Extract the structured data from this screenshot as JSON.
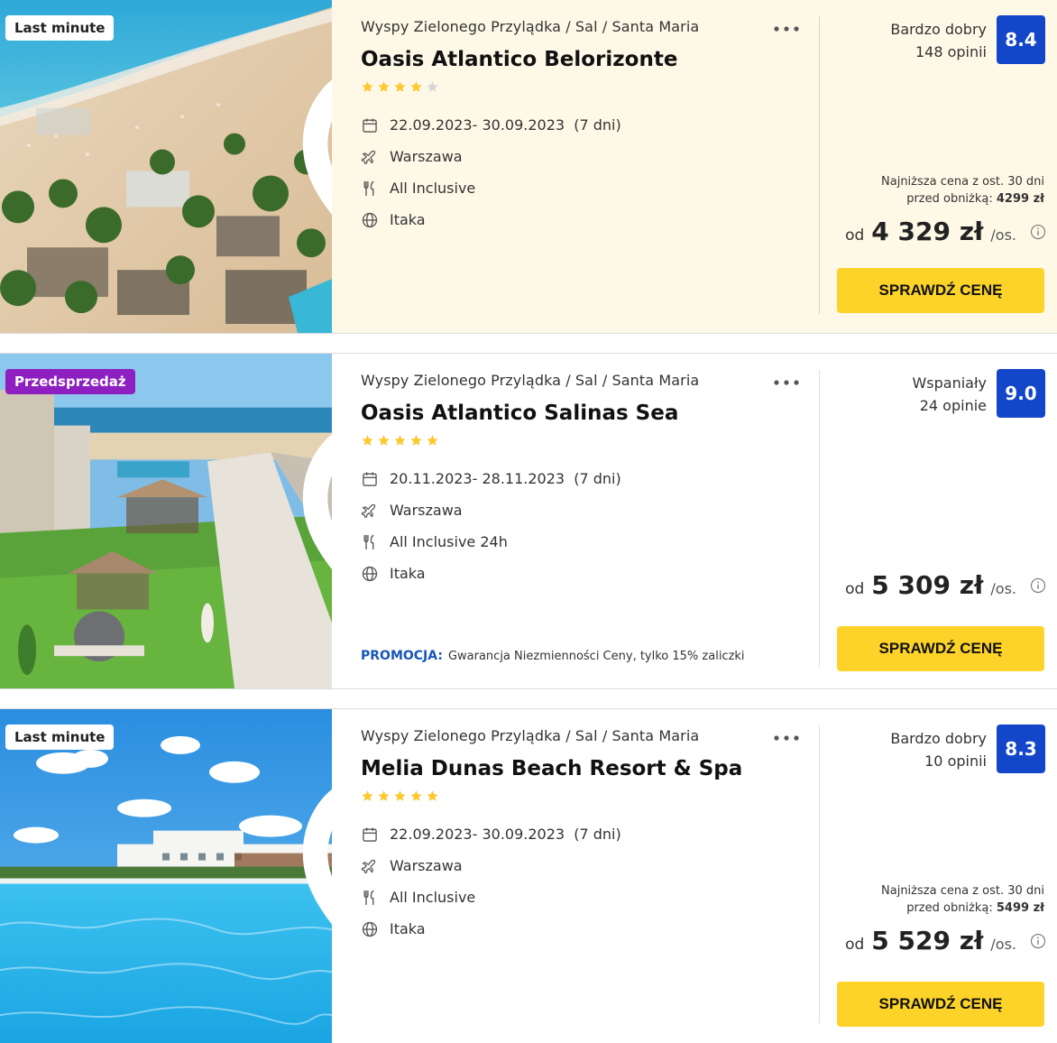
{
  "offers": [
    {
      "badge": "Last minute",
      "location": "Wyspy Zielonego Przylądka / Sal / Santa Maria",
      "name": "Oasis Atlantico Belorizonte",
      "stars": 4,
      "dates": "22.09.2023- 30.09.2023",
      "duration": "(7 dni)",
      "departure": "Warszawa",
      "board": "All Inclusive",
      "operator": "Itaka",
      "rating_label": "Bardzo dobry",
      "reviews": "148 opinii",
      "score": "8.4",
      "lowest_text": "Najniższa cena z ost. 30 dni",
      "lowest_prefix": "przed obniżką:",
      "lowest_price": "4299 zł",
      "price_from": "od",
      "price": "4 329 zł",
      "per_person": "/os.",
      "cta": "SPRAWDŹ CENĘ"
    },
    {
      "badge": "Przedsprzedaż",
      "location": "Wyspy Zielonego Przylądka / Sal / Santa Maria",
      "name": "Oasis Atlantico Salinas Sea",
      "stars": 5,
      "dates": "20.11.2023- 28.11.2023",
      "duration": "(7 dni)",
      "departure": "Warszawa",
      "board": "All Inclusive 24h",
      "operator": "Itaka",
      "rating_label": "Wspaniały",
      "reviews": "24 opinie",
      "score": "9.0",
      "promo_label": "PROMOCJA:",
      "promo_text": "Gwarancja Niezmienności Ceny, tylko 15% zaliczki",
      "price_from": "od",
      "price": "5 309 zł",
      "per_person": "/os.",
      "cta": "SPRAWDŹ CENĘ"
    },
    {
      "badge": "Last minute",
      "location": "Wyspy Zielonego Przylądka / Sal / Santa Maria",
      "name": "Melia Dunas Beach Resort & Spa",
      "stars": 5,
      "dates": "22.09.2023- 30.09.2023",
      "duration": "(7 dni)",
      "departure": "Warszawa",
      "board": "All Inclusive",
      "operator": "Itaka",
      "rating_label": "Bardzo dobry",
      "reviews": "10 opinii",
      "score": "8.3",
      "lowest_text": "Najniższa cena z ost. 30 dni",
      "lowest_prefix": "przed obniżką:",
      "lowest_price": "5499 zł",
      "price_from": "od",
      "price": "5 529 zł",
      "per_person": "/os.",
      "cta": "SPRAWDŹ CENĘ"
    }
  ],
  "colors": {
    "cta": "#fdd32a",
    "score": "#1346c9",
    "presale_badge": "#8e1fc0",
    "star": "#fdc82e",
    "highlight_bg": "#fef9e7",
    "promo": "#1a56b8"
  },
  "icons": {
    "favorite": "heart-icon",
    "menu": "more-dots-icon",
    "dates": "calendar-icon",
    "departure": "plane-icon",
    "board": "cutlery-icon",
    "operator": "globe-icon",
    "price_info": "info-icon"
  }
}
